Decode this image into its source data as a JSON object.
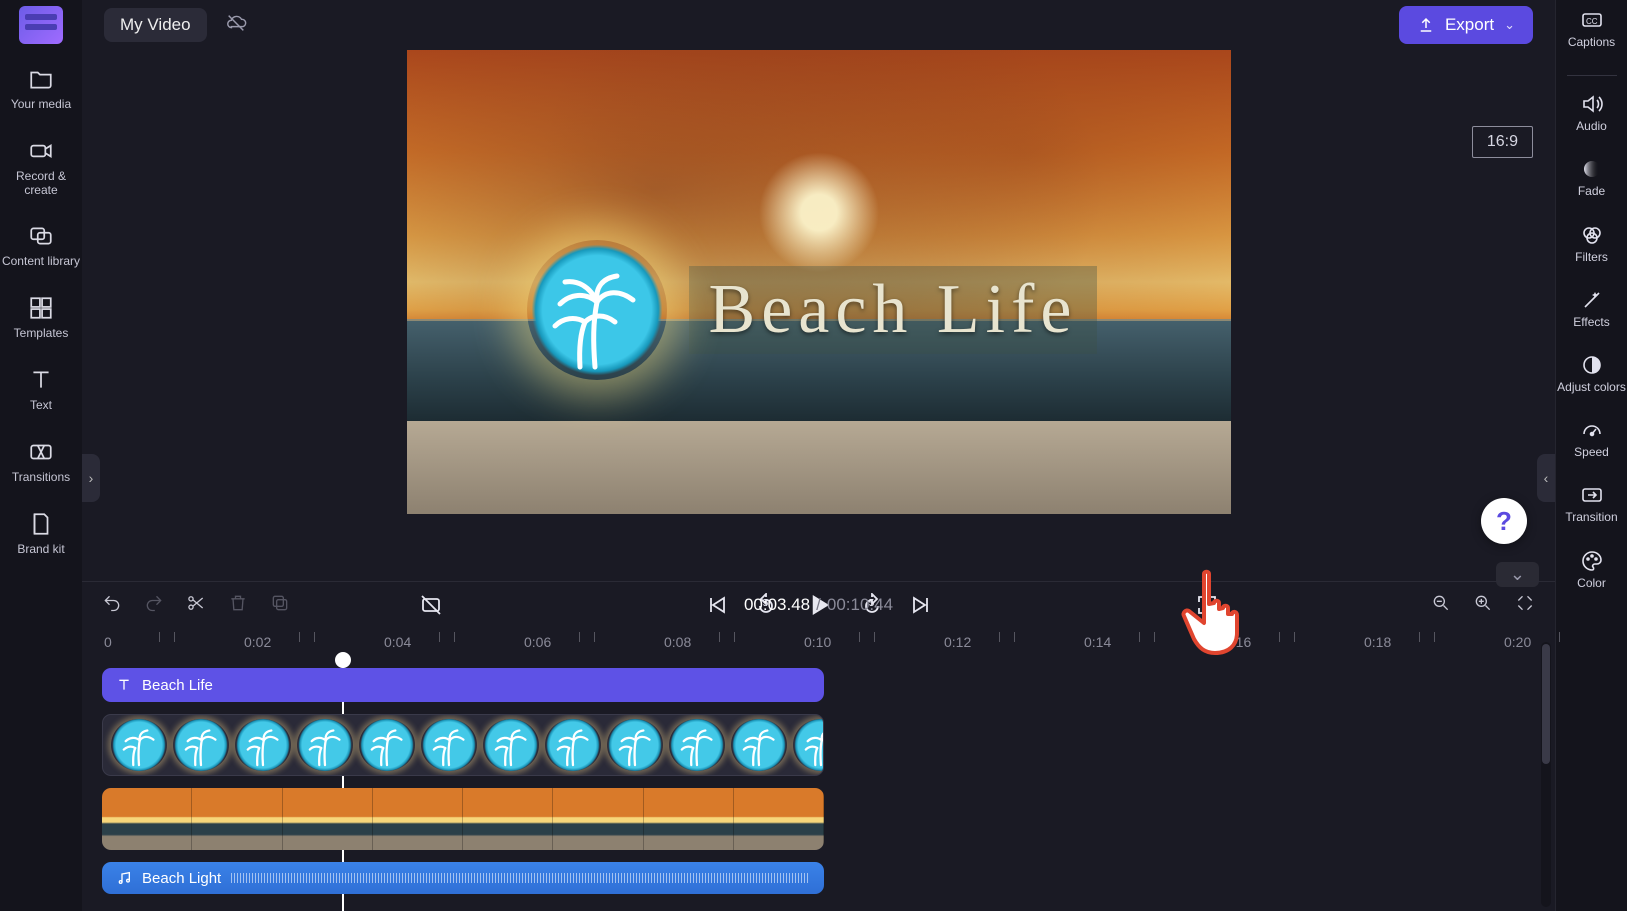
{
  "header": {
    "title": "My Video",
    "export_label": "Export"
  },
  "preview": {
    "aspect_label": "16:9",
    "overlay_text": "Beach Life"
  },
  "left_nav": {
    "media": "Your media",
    "record": "Record & create",
    "library": "Content library",
    "templates": "Templates",
    "text": "Text",
    "transitions": "Transitions",
    "brandkit": "Brand kit"
  },
  "right_nav": {
    "captions": "Captions",
    "audio": "Audio",
    "fade": "Fade",
    "filters": "Filters",
    "effects": "Effects",
    "adjust": "Adjust colors",
    "speed": "Speed",
    "transition": "Transition",
    "color": "Color"
  },
  "transport": {
    "current": "00:03.48",
    "total": "00:10.44"
  },
  "ruler": {
    "marks": [
      "0",
      "0:02",
      "0:04",
      "0:06",
      "0:08",
      "0:10",
      "0:12",
      "0:14",
      "0:16",
      "0:18",
      "0:20"
    ]
  },
  "tracks": {
    "text_label": "Beach Life",
    "audio_label": "Beach Light"
  },
  "help_symbol": "?"
}
